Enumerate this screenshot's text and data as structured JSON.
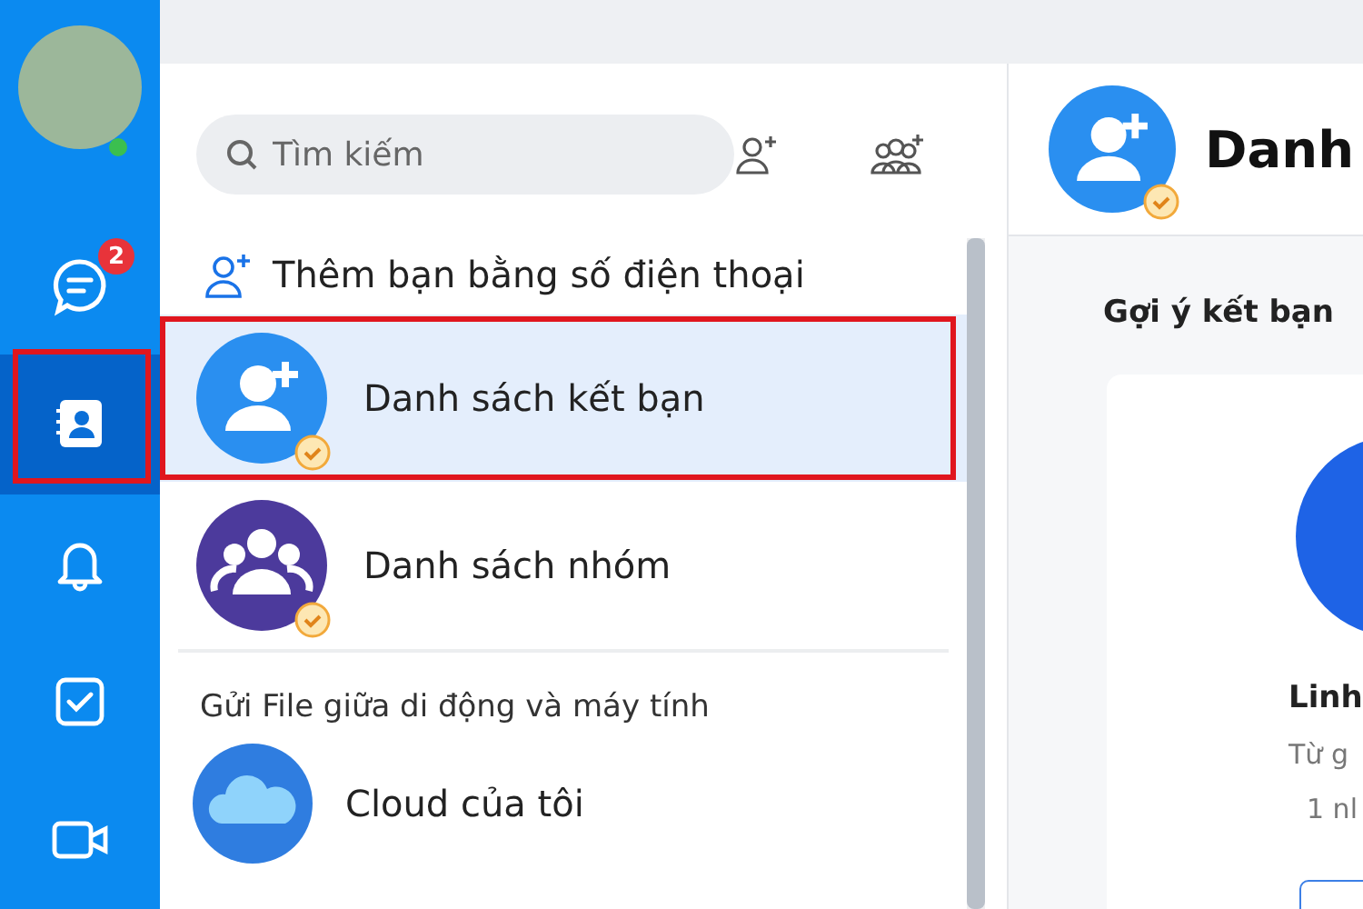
{
  "nav": [
    {
      "kind": "avatar",
      "online": true
    },
    {
      "kind": "chat",
      "selected": false,
      "highlighted": false,
      "badge": "2"
    },
    {
      "kind": "contacts",
      "selected": true,
      "highlighted": true
    },
    {
      "kind": "bell",
      "selected": false,
      "highlighted": false
    },
    {
      "kind": "todo",
      "selected": false,
      "highlighted": false
    },
    {
      "kind": "video",
      "selected": false,
      "highlighted": false
    }
  ],
  "search": {
    "placeholder": "Tìm kiếm"
  },
  "add_phone": {
    "label": "Thêm bạn bằng số điện thoại"
  },
  "lists": [
    {
      "kind": "friends",
      "label": "Danh sách kết bạn",
      "selected": true,
      "highlighted": true,
      "verified": true
    },
    {
      "kind": "groups",
      "label": "Danh sách nhóm",
      "selected": false,
      "highlighted": false,
      "verified": true
    }
  ],
  "section": {
    "title": "Gửi File giữa di động và máy tính"
  },
  "cloud": {
    "label": "Cloud của tôi"
  },
  "header": {
    "title": "Danh",
    "verified": true
  },
  "suggest": {
    "title": "Gợi ý kết bạn",
    "card": {
      "name": "Linh",
      "line_1": "Từ g",
      "line_2": "1 nl"
    }
  }
}
